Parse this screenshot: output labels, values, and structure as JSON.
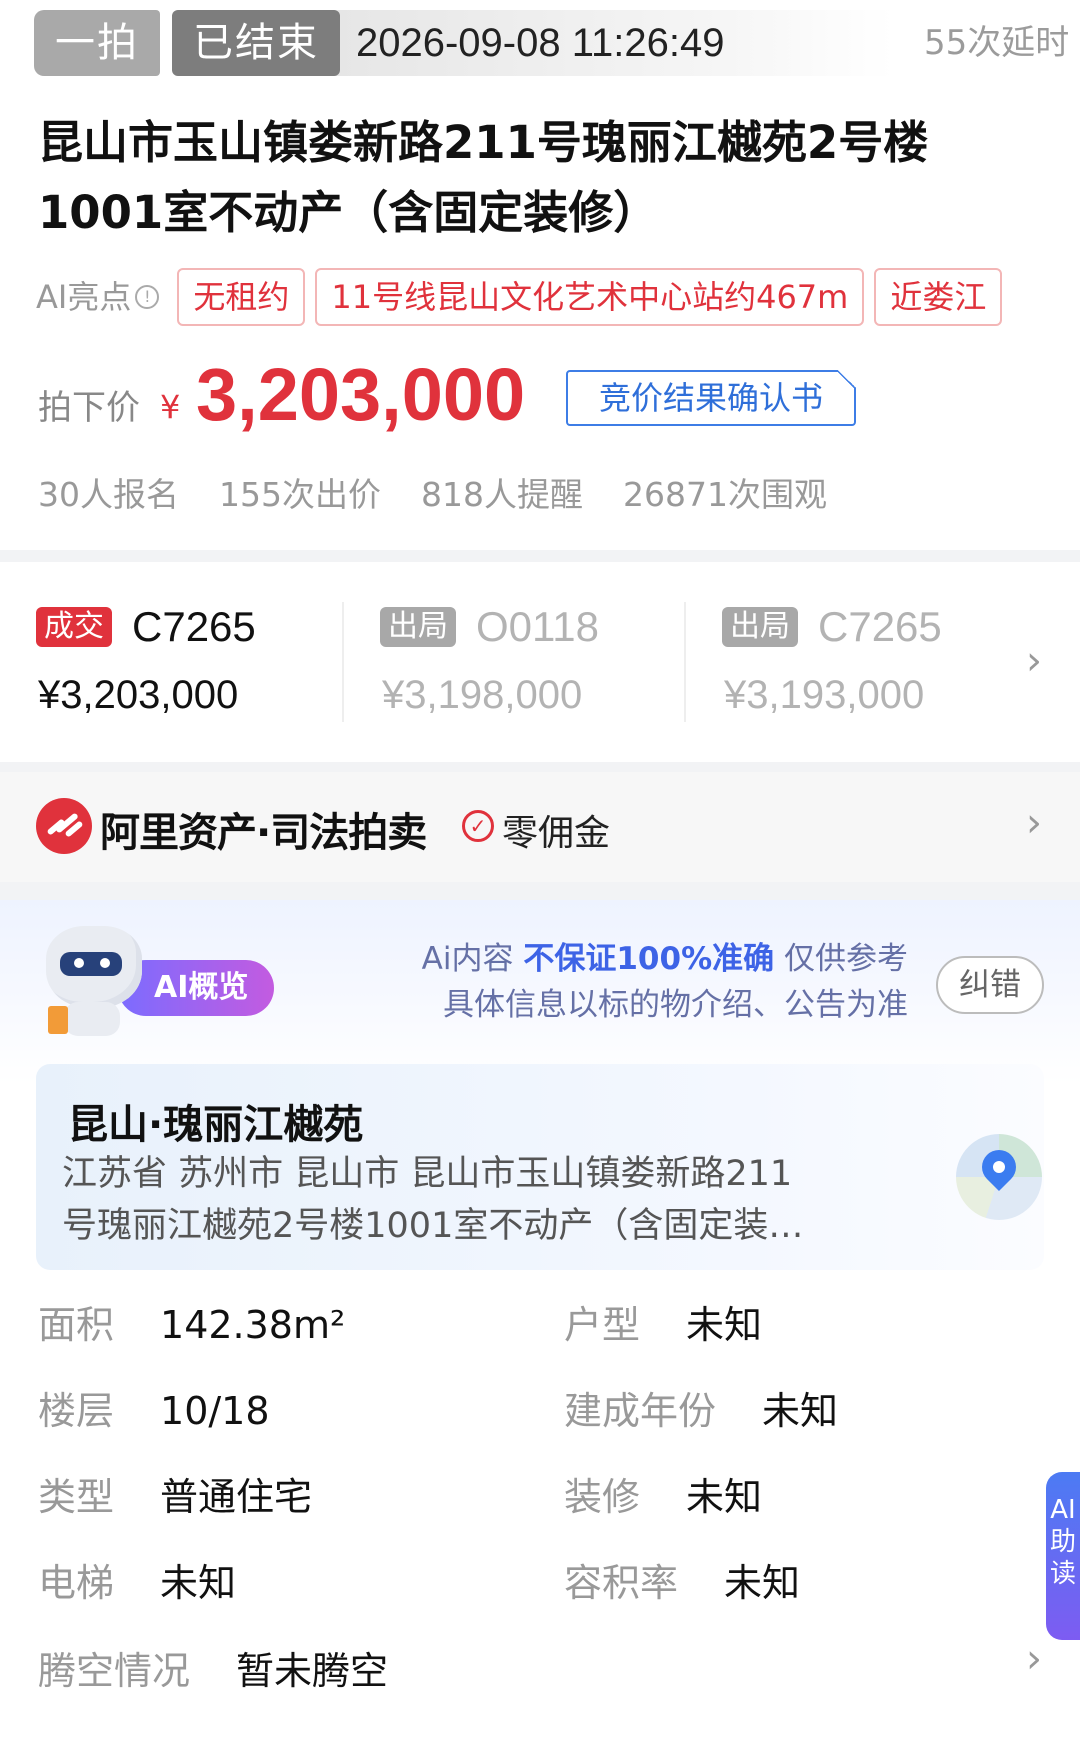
{
  "status": {
    "round": "一拍",
    "state": "已结束",
    "end_time": "2026-09-08 11:26:49",
    "delay_count": "55次延时"
  },
  "title": "昆山市玉山镇娄新路211号瑰丽江樾苑2号楼1001室不动产（含固定装修）",
  "ai_highlights": {
    "label": "AI亮点",
    "tags": [
      "无租约",
      "11号线昆山文化艺术中心站约467m",
      "近娄江"
    ]
  },
  "price": {
    "label": "拍下价",
    "currency": "¥",
    "value": "3,203,000",
    "confirm_button": "竞价结果确认书"
  },
  "stats": [
    "30人报名",
    "155次出价",
    "818人提醒",
    "26871次围观"
  ],
  "bids": [
    {
      "tag": "成交",
      "code": "C7265",
      "price": "¥3,203,000",
      "status": "deal"
    },
    {
      "tag": "出局",
      "code": "O0118",
      "price": "¥3,198,000",
      "status": "out"
    },
    {
      "tag": "出局",
      "code": "C7265",
      "price": "¥3,193,000",
      "status": "out"
    }
  ],
  "platform": {
    "name": "阿里资产·司法拍卖",
    "badge": "零佣金"
  },
  "ai_overview": {
    "pill": "AI概览",
    "note_prefix": "Ai内容",
    "note_em": "不保证100%准确",
    "note_suffix": "仅供参考",
    "note_line2": "具体信息以标的物介绍、公告为准",
    "correct_button": "纠错"
  },
  "address": {
    "name": "昆山·瑰丽江樾苑",
    "line1": "江苏省 苏州市 昆山市 昆山市玉山镇娄新路211",
    "line2": "号瑰丽江樾苑2号楼1001室不动产（含固定装…"
  },
  "properties": {
    "area_k": "面积",
    "area_v": "142.38m²",
    "layout_k": "户型",
    "layout_v": "未知",
    "floor_k": "楼层",
    "floor_v": "10/18",
    "year_k": "建成年份",
    "year_v": "未知",
    "type_k": "类型",
    "type_v": "普通住宅",
    "deco_k": "装修",
    "deco_v": "未知",
    "elevator_k": "电梯",
    "elevator_v": "未知",
    "plot_k": "容积率",
    "plot_v": "未知",
    "vacancy_k": "腾空情况",
    "vacancy_v": "暂未腾空"
  },
  "side_tab": "AI助读",
  "colors": {
    "accent_red": "#e0323c",
    "link_blue": "#3d7de6"
  }
}
